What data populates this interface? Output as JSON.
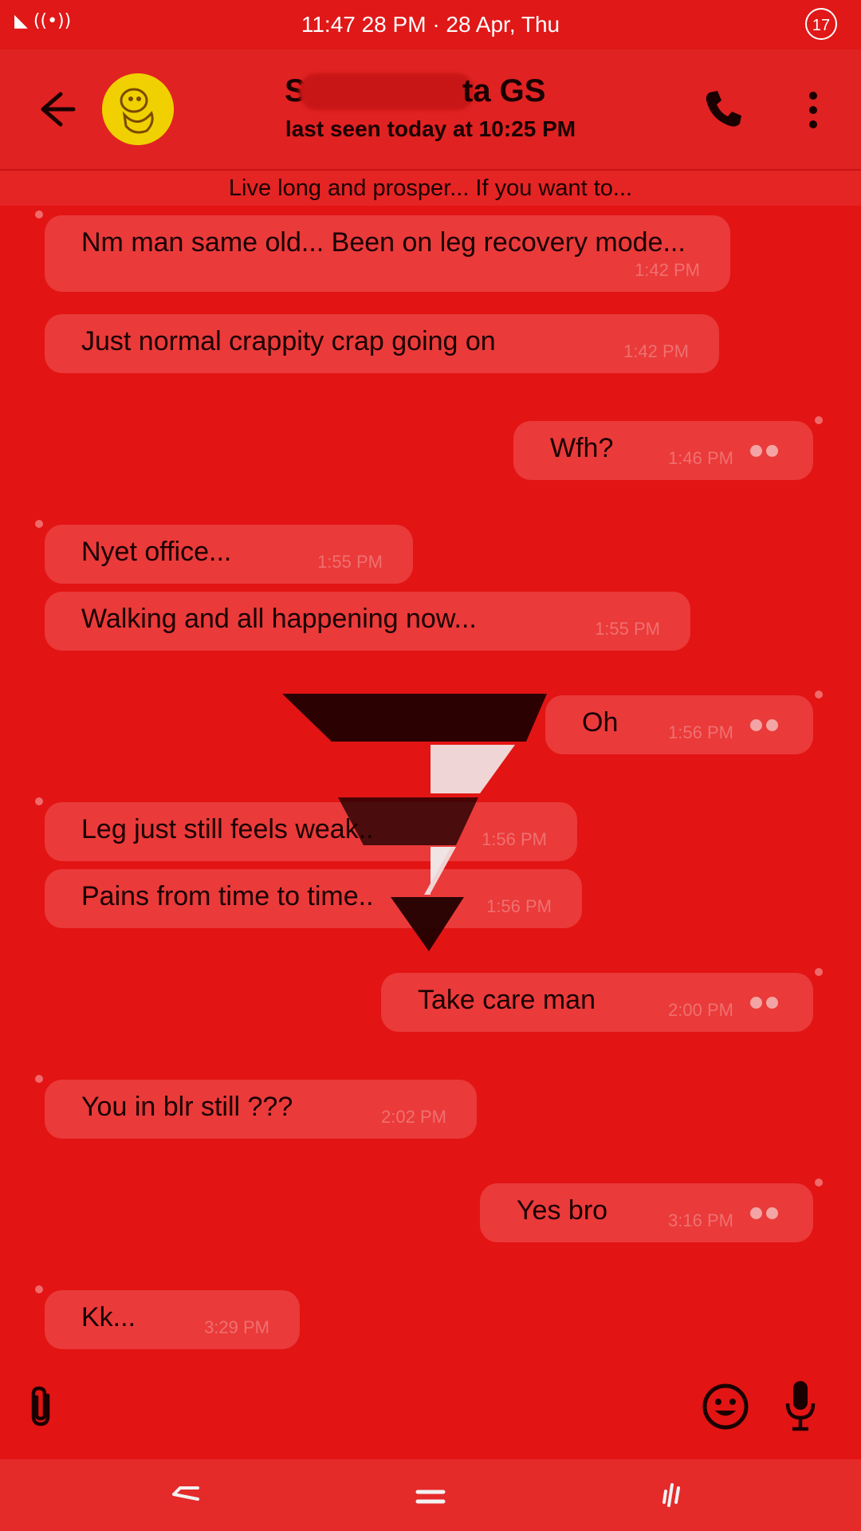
{
  "status_bar": {
    "left_icons": "◣ ((•))",
    "time": "11:47 28 PM · 28 Apr, Thu",
    "notification_count": "17"
  },
  "header": {
    "contact_name_visible_start": "S",
    "contact_name_visible_end": "ta GS",
    "last_seen": "last seen today at 10:25 PM",
    "icons": [
      "back-arrow-icon",
      "avatar",
      "phone-icon",
      "more-vertical-icon"
    ]
  },
  "status_message": "Live long and prosper... If you want to...",
  "messages": [
    {
      "dir": "in",
      "text": "Nm man same old... Been on leg recovery mode...",
      "time": "1:42 PM"
    },
    {
      "dir": "in",
      "text": "Just normal crappity crap going on",
      "time": "1:42 PM"
    },
    {
      "dir": "out",
      "text": "Wfh?",
      "time": "1:46 PM"
    },
    {
      "dir": "in",
      "text": "Nyet office...",
      "time": "1:55 PM"
    },
    {
      "dir": "in",
      "text": "Walking and all happening now...",
      "time": "1:55 PM"
    },
    {
      "dir": "out",
      "text": "Oh",
      "time": "1:56 PM"
    },
    {
      "dir": "in",
      "text": "Leg just still feels weak..",
      "time": "1:56 PM"
    },
    {
      "dir": "in",
      "text": "Pains from time to time..",
      "time": "1:56 PM"
    },
    {
      "dir": "out",
      "text": "Take care man",
      "time": "2:00 PM"
    },
    {
      "dir": "in",
      "text": "You in blr still ???",
      "time": "2:02 PM"
    },
    {
      "dir": "out",
      "text": "Yes bro",
      "time": "3:16 PM"
    },
    {
      "dir": "in",
      "text": "Kk...",
      "time": "3:29 PM"
    }
  ],
  "input_bar": {
    "icons": [
      "attach-icon",
      "emoji-icon",
      "microphone-icon"
    ]
  },
  "nav_bar": {
    "icons": [
      "nav-back-icon",
      "nav-home-icon",
      "nav-recent-icon"
    ]
  },
  "colors": {
    "background": "#e31414",
    "bubble": "#ea3a3a",
    "text": "#1a0000"
  }
}
